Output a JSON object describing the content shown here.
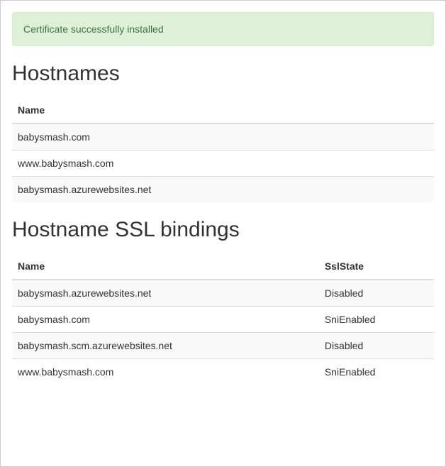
{
  "alert": {
    "message": "Certificate successfully installed"
  },
  "hostnames": {
    "heading": "Hostnames",
    "columns": {
      "name": "Name"
    },
    "rows": [
      {
        "name": "babysmash.com"
      },
      {
        "name": "www.babysmash.com"
      },
      {
        "name": "babysmash.azurewebsites.net"
      }
    ]
  },
  "sslBindings": {
    "heading": "Hostname SSL bindings",
    "columns": {
      "name": "Name",
      "sslState": "SslState"
    },
    "rows": [
      {
        "name": "babysmash.azurewebsites.net",
        "sslState": "Disabled"
      },
      {
        "name": "babysmash.com",
        "sslState": "SniEnabled"
      },
      {
        "name": "babysmash.scm.azurewebsites.net",
        "sslState": "Disabled"
      },
      {
        "name": "www.babysmash.com",
        "sslState": "SniEnabled"
      }
    ]
  }
}
